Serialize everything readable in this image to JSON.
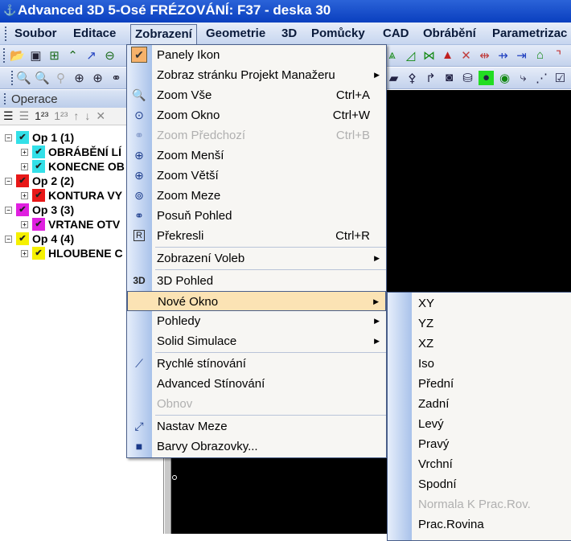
{
  "window": {
    "title": "Advanced 3D 5-Osé FRÉZOVÁNÍ: F37 - deska 30"
  },
  "menubar": [
    "Soubor",
    "Editace",
    "Zobrazení",
    "Geometrie",
    "3D",
    "Pomůcky",
    "CAD",
    "Obrábění",
    "Parametrizac"
  ],
  "panel": {
    "title": "Operace",
    "tools": [
      "list-icon",
      "list-disabled-icon",
      "1²³",
      "1²³",
      "↑",
      "↓",
      "✕"
    ]
  },
  "tree": [
    {
      "label": "Op 1   (1)",
      "level": 0,
      "color": "#33e0e8"
    },
    {
      "label": "OBRÁBĚNÍ LÍ",
      "level": 1,
      "color": "#33e0e8"
    },
    {
      "label": "KONECNE OB",
      "level": 1,
      "color": "#33e0e8"
    },
    {
      "label": "Op 2   (2)",
      "level": 0,
      "color": "#e81818"
    },
    {
      "label": "KONTURA VY",
      "level": 1,
      "color": "#e81818"
    },
    {
      "label": "Op 3   (3)",
      "level": 0,
      "color": "#e020e0"
    },
    {
      "label": "VRTANE OTV",
      "level": 1,
      "color": "#e020e0"
    },
    {
      "label": "Op 4   (4)",
      "level": 0,
      "color": "#f5f000"
    },
    {
      "label": "HLOUBENE C",
      "level": 1,
      "color": "#f5f000"
    }
  ],
  "menu": {
    "items": [
      {
        "label": "Panely Ikon",
        "icon": "check-icon",
        "checked": true
      },
      {
        "label": "Zobraz stránku Projekt Manažeru",
        "submenu": true
      },
      {
        "label": "Zoom Vše",
        "shortcut": "Ctrl+A",
        "icon": "zoom-all-icon"
      },
      {
        "label": "Zoom Okno",
        "shortcut": "Ctrl+W",
        "icon": "zoom-window-icon"
      },
      {
        "label": "Zoom Předchozí",
        "shortcut": "Ctrl+B",
        "icon": "zoom-previous-icon",
        "disabled": true
      },
      {
        "label": "Zoom Menší",
        "icon": "zoom-out-icon"
      },
      {
        "label": "Zoom Větší",
        "icon": "zoom-in-icon"
      },
      {
        "label": "Zoom Meze",
        "icon": "zoom-extents-icon"
      },
      {
        "label": "Posuň Pohled",
        "icon": "pan-icon"
      },
      {
        "label": "Překresli",
        "shortcut": "Ctrl+R",
        "icon": "redraw-icon"
      },
      {
        "label": "Zobrazení Voleb",
        "submenu": true,
        "sep_before": true
      },
      {
        "label": "3D Pohled",
        "icon": "3d-icon",
        "sep_before": true
      },
      {
        "label": "Nové Okno",
        "submenu": true,
        "highlighted": true
      },
      {
        "label": "Pohledy",
        "submenu": true
      },
      {
        "label": "Solid Simulace",
        "submenu": true
      },
      {
        "label": "Rychlé stínování",
        "icon": "shading-icon",
        "sep_before": true
      },
      {
        "label": "Advanced Stínování"
      },
      {
        "label": "Obnov",
        "disabled": true
      },
      {
        "label": "Nastav Meze",
        "icon": "resize-icon",
        "sep_before": true
      },
      {
        "label": "Barvy Obrazovky...",
        "icon": "screen-colors-icon"
      }
    ],
    "icon_3d_text": "3D",
    "icon_redraw_text": "R"
  },
  "submenu": {
    "items": [
      {
        "label": "XY"
      },
      {
        "label": "YZ"
      },
      {
        "label": "XZ"
      },
      {
        "label": "Iso"
      },
      {
        "label": "Přední"
      },
      {
        "label": "Zadní"
      },
      {
        "label": "Levý"
      },
      {
        "label": "Pravý"
      },
      {
        "label": "Vrchní"
      },
      {
        "label": "Spodní"
      },
      {
        "label": "Normala K Prac.Rov.",
        "disabled": true
      },
      {
        "label": "Prac.Rovina"
      }
    ]
  }
}
